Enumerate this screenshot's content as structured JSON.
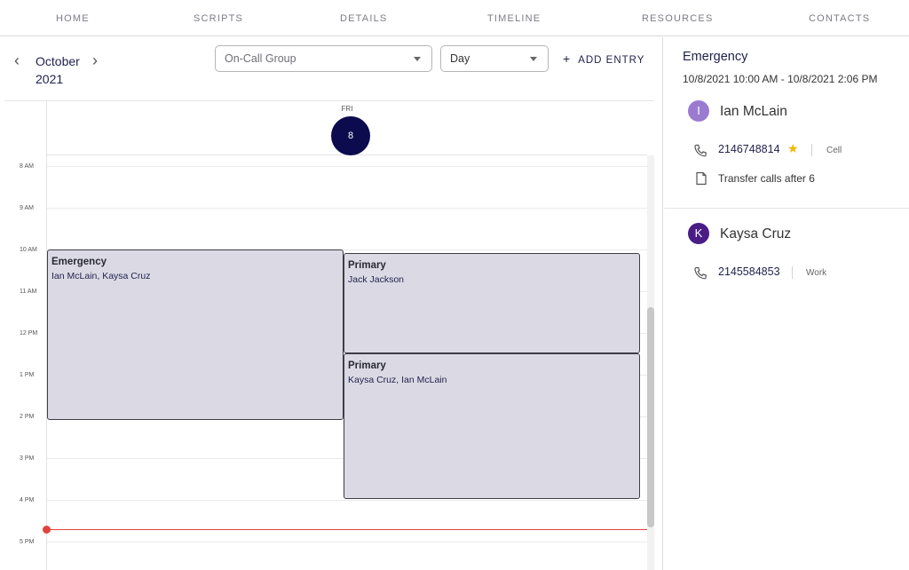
{
  "nav": {
    "items": [
      "HOME",
      "SCRIPTS",
      "DETAILS",
      "TIMELINE",
      "RESOURCES",
      "CONTACTS"
    ]
  },
  "toolbar": {
    "month": "October",
    "year": "2021",
    "group_select": {
      "value": "On-Call Group"
    },
    "view_select": {
      "value": "Day"
    },
    "add_entry_label": "ADD ENTRY"
  },
  "calendar": {
    "day_of_week": "FRI",
    "day_number": "8",
    "hours": [
      "8 AM",
      "9 AM",
      "10 AM",
      "11 AM",
      "12 PM",
      "1 PM",
      "2 PM",
      "3 PM",
      "4 PM",
      "5 PM"
    ],
    "events": [
      {
        "title": "Emergency",
        "people": "Ian McLain,  Kaysa Cruz"
      },
      {
        "title": "Primary",
        "people": "Jack Jackson"
      },
      {
        "title": "Primary",
        "people": "Kaysa Cruz,  Ian McLain"
      }
    ]
  },
  "detail": {
    "title": "Emergency",
    "range": "10/8/2021 10:00 AM - 10/8/2021 2:06 PM",
    "contacts": [
      {
        "initial": "I",
        "name": "Ian McLain",
        "avatar_color": "#9b7bd0",
        "phone": "2146748814",
        "phone_type": "Cell",
        "note": "Transfer calls after 6"
      },
      {
        "initial": "K",
        "name": "Kaysa Cruz",
        "avatar_color": "#4a1d86",
        "phone": "2145584853",
        "phone_type": "Work"
      }
    ]
  },
  "colors": {
    "accent": "#0b0b4e",
    "event_fill": "#dbdae4",
    "now_line": "#e2423c",
    "star": "#f2b705"
  }
}
